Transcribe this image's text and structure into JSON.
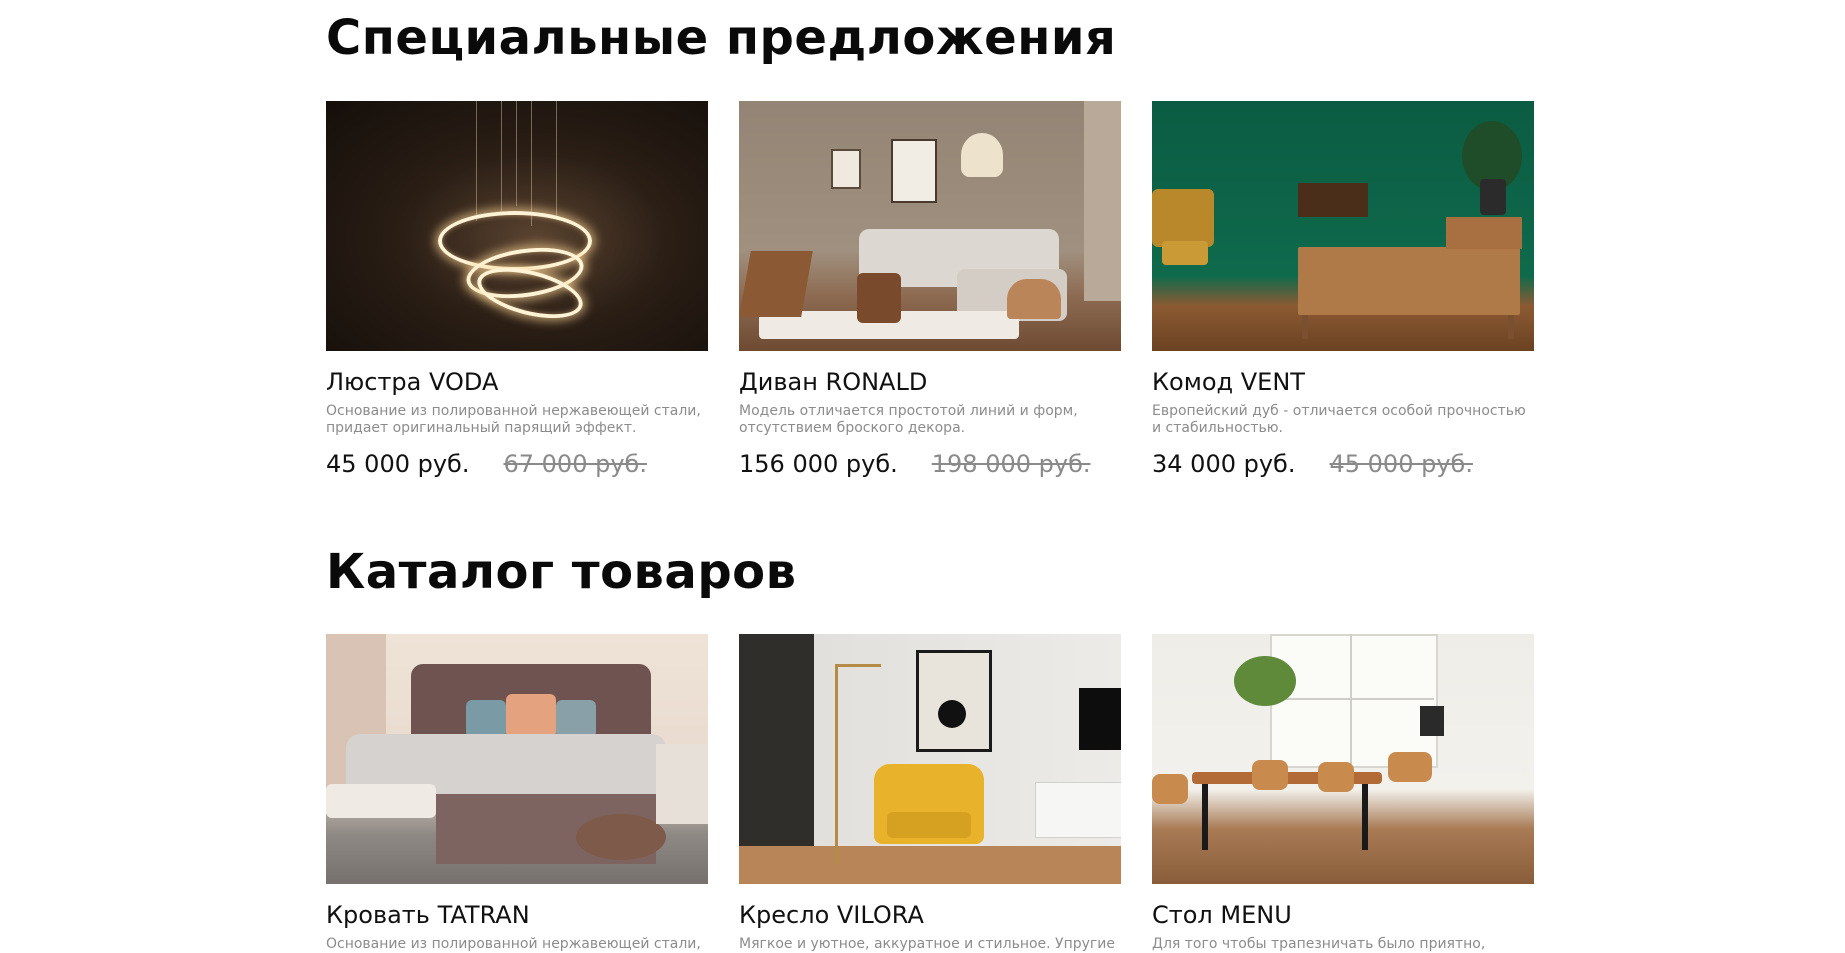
{
  "sections": {
    "special": {
      "title": "Специальные предложения",
      "items": [
        {
          "title": "Люстра VODA",
          "description": "Основание из полированной нержавеющей стали, придает оригинальный парящий эффект.",
          "price": "45 000 руб.",
          "old_price": "67 000 руб.",
          "image": "chandelier-photo"
        },
        {
          "title": "Диван RONALD",
          "description": "Модель отличается простотой линий и форм, отсутствием броского декора.",
          "price": "156 000 руб.",
          "old_price": "198 000 руб.",
          "image": "living-room-sofa-photo"
        },
        {
          "title": "Комод VENT",
          "description": "Европейский дуб - отличается особой прочностью и стабильностью.",
          "price": "34 000 руб.",
          "old_price": "45 000 руб.",
          "image": "green-room-dresser-photo"
        }
      ]
    },
    "catalog": {
      "title": "Каталог товаров",
      "items": [
        {
          "title": "Кровать TATRAN",
          "description": "Основание из полированной нержавеющей стали,",
          "image": "bedroom-bed-photo"
        },
        {
          "title": "Кресло VILORA",
          "description": "Мягкое и уютное, аккуратное и стильное. Упругие",
          "image": "yellow-armchair-photo"
        },
        {
          "title": "Стол MENU",
          "description": "Для того чтобы трапезничать было приятно,",
          "image": "dining-table-photo"
        }
      ]
    }
  },
  "colors": {
    "heading": "#0a0a0a",
    "text": "#111111",
    "muted": "#8c8c8c",
    "strike": "#8a8a8a",
    "background": "#ffffff"
  }
}
